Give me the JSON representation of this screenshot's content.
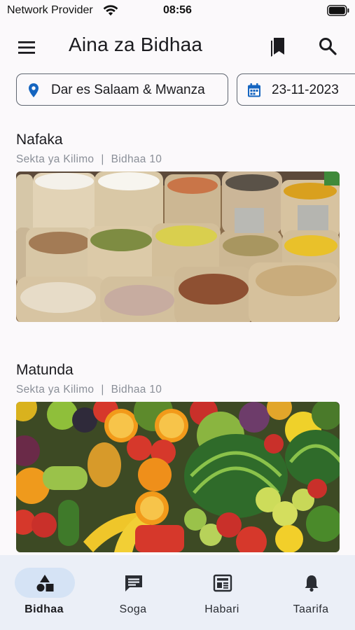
{
  "status_bar": {
    "carrier": "Network Provider",
    "time": "08:56",
    "wifi_icon": "wifi-icon",
    "battery_icon": "battery-icon"
  },
  "app_bar": {
    "title": "Aina za Bidhaa",
    "menu_icon": "menu-icon",
    "bookmark_icon": "bookmark-icon",
    "search_icon": "search-icon"
  },
  "filters": {
    "location": {
      "icon": "location-pin-icon",
      "label": "Dar es Salaam & Mwanza"
    },
    "date": {
      "icon": "calendar-icon",
      "label": "23-11-2023"
    }
  },
  "categories": [
    {
      "title": "Nafaka",
      "sector": "Sekta ya Kilimo",
      "separator": "|",
      "count": "Bidhaa 10",
      "image": "grain-sacks-image"
    },
    {
      "title": "Matunda",
      "sector": "Sekta ya Kilimo",
      "separator": "|",
      "count": "Bidhaa 10",
      "image": "fruits-vegetables-image"
    }
  ],
  "bottom_nav": {
    "items": [
      {
        "label": "Bidhaa",
        "icon": "shapes-icon",
        "active": true
      },
      {
        "label": "Soga",
        "icon": "chat-icon",
        "active": false
      },
      {
        "label": "Habari",
        "icon": "news-icon",
        "active": false
      },
      {
        "label": "Taarifa",
        "icon": "bell-icon",
        "active": false
      }
    ]
  },
  "colors": {
    "accent": "#1565c0",
    "background": "#fbf9fb",
    "nav_background": "#ebeff7",
    "active_pill": "#d5e3f5",
    "meta_text": "#8a8f98"
  }
}
